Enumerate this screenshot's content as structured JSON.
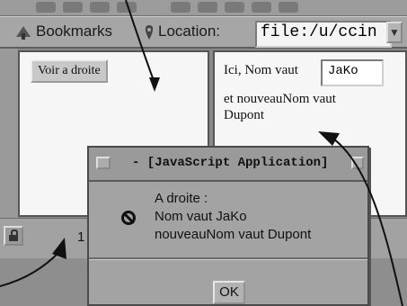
{
  "browser": {
    "bookmarks_label": "Bookmarks",
    "location_label": "Location:",
    "location_value": "file:/u/ccin"
  },
  "left_frame": {
    "button_label": "Voir a droite"
  },
  "right_frame": {
    "prefix": "Ici, Nom vaut",
    "name_value": "JaKo",
    "line2": "et nouveauNom vaut",
    "line3": "Dupont"
  },
  "dialog": {
    "title": "- [JavaScript Application]",
    "message_line1": "A droite :",
    "message_line2": "Nom vaut JaKo",
    "message_line3": "nouveauNom vaut Dupont",
    "ok_label": "OK"
  },
  "status": {
    "fragment": "1"
  }
}
